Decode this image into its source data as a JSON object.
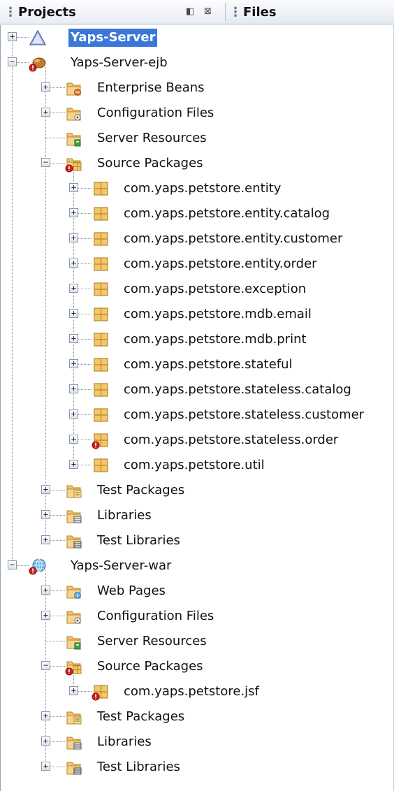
{
  "tabs": {
    "projects": {
      "label": "Projects"
    },
    "files": {
      "label": "Files"
    }
  },
  "colors": {
    "selection": "#3b77d8",
    "folder": "#f2c36a",
    "package": "#f5c76b",
    "error_badge": "#d32020"
  },
  "tree": [
    {
      "label": "Yaps-Server",
      "depth": 0,
      "toggle": "+",
      "icon": "triangle-project-icon",
      "selected": true
    },
    {
      "label": "Yaps-Server-ejb",
      "depth": 0,
      "toggle": "-",
      "icon": "ejb-module-icon",
      "error": true
    },
    {
      "label": "Enterprise Beans",
      "depth": 1,
      "toggle": "+",
      "icon": "enterprise-beans-folder-icon"
    },
    {
      "label": "Configuration Files",
      "depth": 1,
      "toggle": "+",
      "icon": "configuration-files-folder-icon"
    },
    {
      "label": "Server Resources",
      "depth": 1,
      "toggle": "",
      "icon": "server-resources-folder-icon"
    },
    {
      "label": "Source Packages",
      "depth": 1,
      "toggle": "-",
      "icon": "source-packages-folder-icon",
      "error": true
    },
    {
      "label": "com.yaps.petstore.entity",
      "depth": 2,
      "toggle": "+",
      "icon": "package-icon"
    },
    {
      "label": "com.yaps.petstore.entity.catalog",
      "depth": 2,
      "toggle": "+",
      "icon": "package-icon"
    },
    {
      "label": "com.yaps.petstore.entity.customer",
      "depth": 2,
      "toggle": "+",
      "icon": "package-icon"
    },
    {
      "label": "com.yaps.petstore.entity.order",
      "depth": 2,
      "toggle": "+",
      "icon": "package-icon"
    },
    {
      "label": "com.yaps.petstore.exception",
      "depth": 2,
      "toggle": "+",
      "icon": "package-icon"
    },
    {
      "label": "com.yaps.petstore.mdb.email",
      "depth": 2,
      "toggle": "+",
      "icon": "package-icon"
    },
    {
      "label": "com.yaps.petstore.mdb.print",
      "depth": 2,
      "toggle": "+",
      "icon": "package-icon"
    },
    {
      "label": "com.yaps.petstore.stateful",
      "depth": 2,
      "toggle": "+",
      "icon": "package-icon"
    },
    {
      "label": "com.yaps.petstore.stateless.catalog",
      "depth": 2,
      "toggle": "+",
      "icon": "package-icon"
    },
    {
      "label": "com.yaps.petstore.stateless.customer",
      "depth": 2,
      "toggle": "+",
      "icon": "package-icon"
    },
    {
      "label": "com.yaps.petstore.stateless.order",
      "depth": 2,
      "toggle": "+",
      "icon": "package-icon",
      "error": true
    },
    {
      "label": "com.yaps.petstore.util",
      "depth": 2,
      "toggle": "+",
      "icon": "package-icon"
    },
    {
      "label": "Test Packages",
      "depth": 1,
      "toggle": "+",
      "icon": "test-packages-folder-icon"
    },
    {
      "label": "Libraries",
      "depth": 1,
      "toggle": "+",
      "icon": "libraries-folder-icon"
    },
    {
      "label": "Test Libraries",
      "depth": 1,
      "toggle": "+",
      "icon": "test-libraries-folder-icon"
    },
    {
      "label": "Yaps-Server-war",
      "depth": 0,
      "toggle": "-",
      "icon": "web-module-globe-icon",
      "error": true
    },
    {
      "label": "Web Pages",
      "depth": 1,
      "toggle": "+",
      "icon": "web-pages-folder-icon"
    },
    {
      "label": "Configuration Files",
      "depth": 1,
      "toggle": "+",
      "icon": "configuration-files-folder-icon"
    },
    {
      "label": "Server Resources",
      "depth": 1,
      "toggle": "",
      "icon": "server-resources-folder-icon"
    },
    {
      "label": "Source Packages",
      "depth": 1,
      "toggle": "-",
      "icon": "source-packages-folder-icon",
      "error": true
    },
    {
      "label": "com.yaps.petstore.jsf",
      "depth": 2,
      "toggle": "+",
      "icon": "package-icon",
      "error": true
    },
    {
      "label": "Test Packages",
      "depth": 1,
      "toggle": "+",
      "icon": "test-packages-folder-icon"
    },
    {
      "label": "Libraries",
      "depth": 1,
      "toggle": "+",
      "icon": "libraries-folder-icon"
    },
    {
      "label": "Test Libraries",
      "depth": 1,
      "toggle": "+",
      "icon": "test-libraries-folder-icon"
    }
  ]
}
